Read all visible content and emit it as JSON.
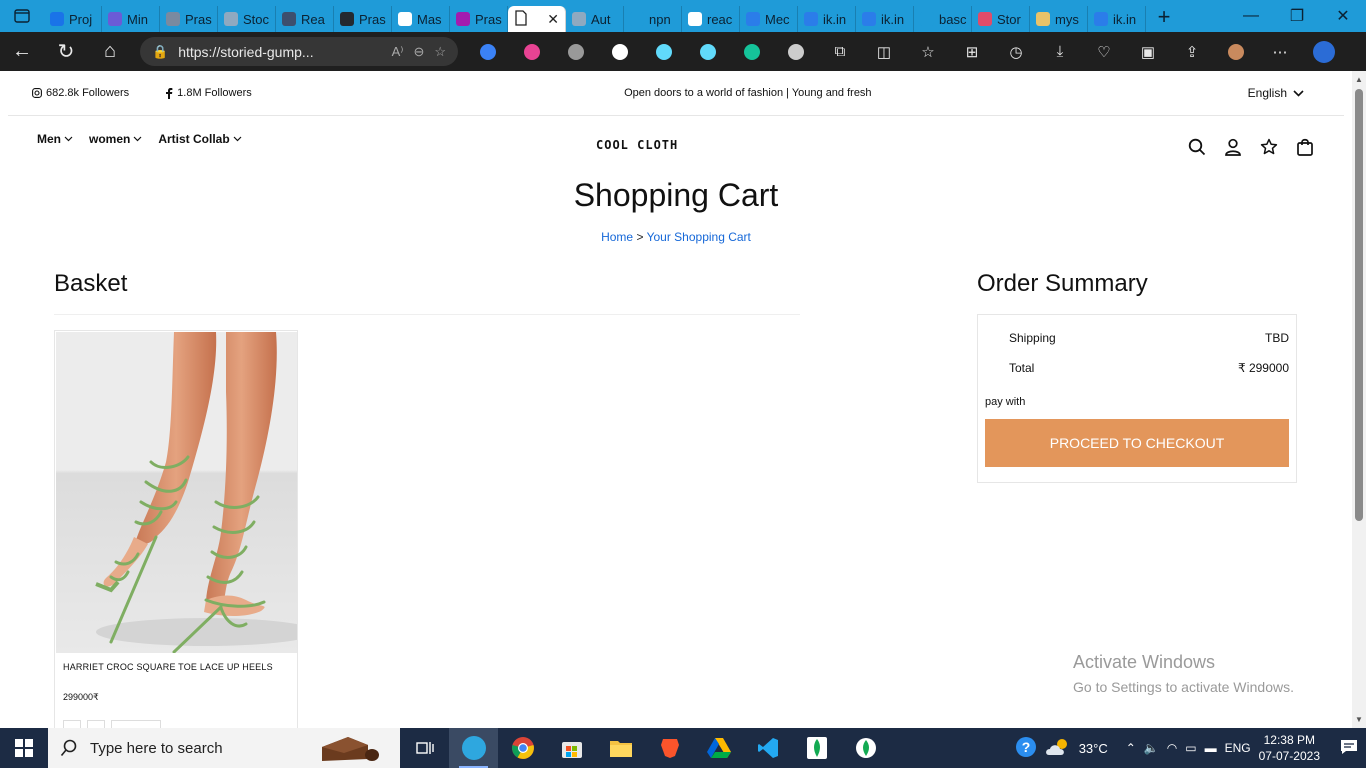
{
  "browser": {
    "tabs": [
      {
        "label": "Proj",
        "color": "#1a73e8"
      },
      {
        "label": "Min",
        "color": "#6b5bd6"
      },
      {
        "label": "Pras",
        "color": "#7a8aa0"
      },
      {
        "label": "Stoc",
        "color": "#8fa9c0"
      },
      {
        "label": "Rea",
        "color": "#3d4f6e"
      },
      {
        "label": "Pras",
        "color": "#24292f"
      },
      {
        "label": "Mas",
        "color": "#ffffff"
      },
      {
        "label": "Pras",
        "color": "#a21caf"
      }
    ],
    "tabs_after": [
      {
        "label": "Aut",
        "color": "#8fa9c0"
      },
      {
        "label": "npn",
        "color": "#1f9bd8"
      },
      {
        "label": "reac",
        "color": "#ffffff"
      },
      {
        "label": "Mec",
        "color": "#2b7de9"
      },
      {
        "label": "ik.in",
        "color": "#2b7de9"
      },
      {
        "label": "ik.in",
        "color": "#2b7de9"
      },
      {
        "label": "basc",
        "color": "#1f9bd8"
      },
      {
        "label": "Stor",
        "color": "#e04c6a"
      },
      {
        "label": "mys",
        "color": "#e8c36a"
      },
      {
        "label": "ik.in",
        "color": "#2b7de9"
      }
    ],
    "url": "https://storied-gump...",
    "extension_colors": [
      "#3b82f6",
      "#e84393",
      "#999999",
      "#ffffff",
      "#61dafb",
      "#61dafb",
      "#15c39a",
      "#cccccc"
    ]
  },
  "topbar": {
    "instagram": "682.8k Followers",
    "facebook": "1.8M Followers",
    "tagline": "Open doors to a world of fashion | Young and fresh",
    "language": "English"
  },
  "nav": {
    "menu": [
      "Men",
      "women",
      "Artist Collab"
    ],
    "logo": "COOL CLOTH"
  },
  "page": {
    "title": "Shopping Cart",
    "crumb_home": "Home",
    "crumb_sep": ">",
    "crumb_current": "Your Shopping Cart"
  },
  "basket": {
    "heading": "Basket",
    "item": {
      "name": "HARRIET CROC SQUARE TOE LACE UP HEELS",
      "price": "299000₹"
    }
  },
  "summary": {
    "heading": "Order Summary",
    "shipping_label": "Shipping",
    "shipping_value": "TBD",
    "total_label": "Total",
    "total_value": "₹ 299000",
    "pay_with": "pay with",
    "checkout": "PROCEED TO CHECKOUT"
  },
  "watermark": {
    "line1": "Activate Windows",
    "line2": "Go to Settings to activate Windows."
  },
  "taskbar": {
    "search_placeholder": "Type here to search",
    "temperature": "33°C",
    "language": "ENG",
    "time": "12:38 PM",
    "date": "07-07-2023"
  }
}
